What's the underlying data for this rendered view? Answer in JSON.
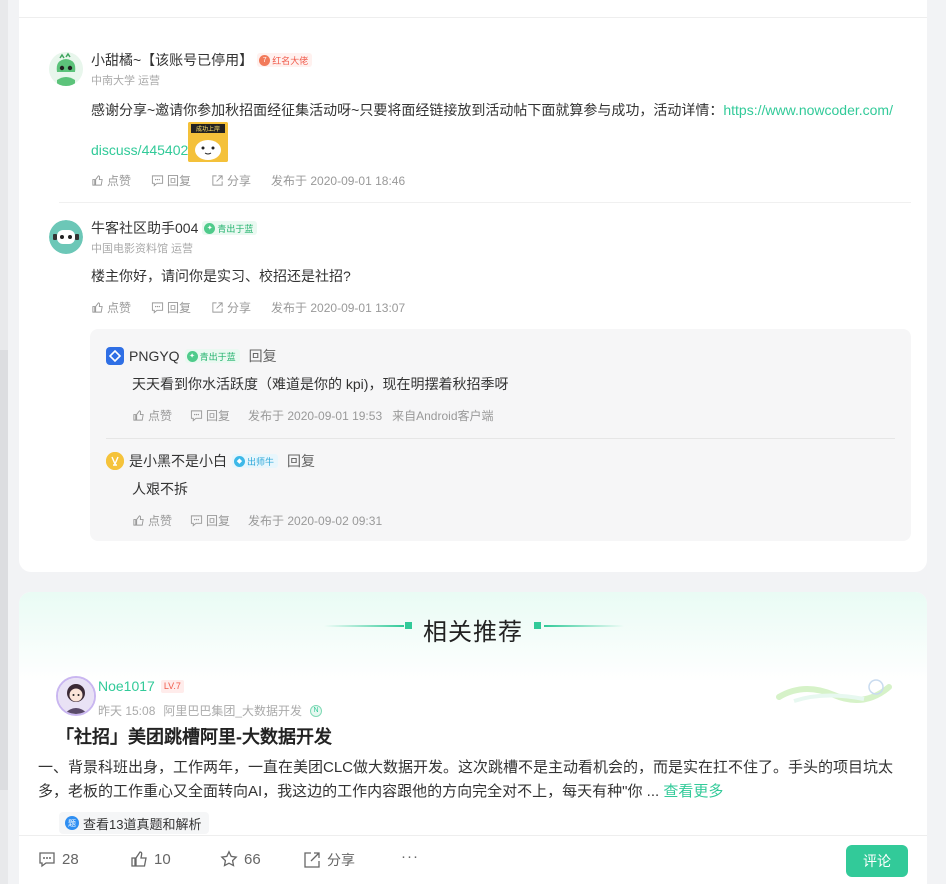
{
  "comments": [
    {
      "name": "小甜橘~【该账号已停用】",
      "badge": "红名大佬",
      "badge_num": "7",
      "sub": "中南大学 运营",
      "text_line1_prefix": "感谢分享~邀请你参加秋招面经征集活动呀~只要将面经链接放到活动帖下面就算参与成功，活动详情：",
      "link_part1": "https://www.nowcoder.com/",
      "link_part2": "discuss/445402",
      "sticker_text": "成功上岸",
      "like": "点赞",
      "reply": "回复",
      "share": "分享",
      "time": "发布于 2020-09-01 18:46"
    },
    {
      "name": "牛客社区助手004",
      "badge": "青出于蓝",
      "sub": "中国电影资料馆 运营",
      "text": "楼主你好，请问你是实习、校招还是社招?",
      "like": "点赞",
      "reply": "回复",
      "share": "分享",
      "time": "发布于 2020-09-01 13:07"
    }
  ],
  "replies": [
    {
      "name": "PNGYQ",
      "badge": "青出于蓝",
      "reply_label": "回复",
      "text": "天天看到你水活跃度（难道是你的 kpi)，现在明摆着秋招季呀",
      "like": "点赞",
      "reply": "回复",
      "time": "发布于 2020-09-01 19:53",
      "source": "来自Android客户端"
    },
    {
      "name": "是小黑不是小白",
      "badge": "出师牛",
      "reply_label": "回复",
      "text": "人艰不拆",
      "like": "点赞",
      "reply": "回复",
      "time": "发布于 2020-09-02 09:31"
    }
  ],
  "recommend": {
    "title": "相关推荐",
    "post": {
      "author": "Noe1017",
      "level": "LV.7",
      "time": "昨天 15:08",
      "company": "阿里巴巴集团_大数据开发",
      "company_badge": "N",
      "title": "「社招」美团跳槽阿里-大数据开发",
      "body": "一、背景科班出身，工作两年，一直在美团CLC做大数据开发。这次跳槽不是主动看机会的，而是实在扛不住了。手头的项目坑太多，老板的工作重心又全面转向AI，我这边的工作内容跟他的方向完全对不上，每天有种\"你 ...",
      "more": "查看更多",
      "chip": "查看13道真题和解析",
      "chip_icon": "题"
    }
  },
  "bottom": {
    "comments_count": "28",
    "likes_count": "10",
    "stars_count": "66",
    "share": "分享",
    "more": "···",
    "comment_button": "评论"
  },
  "colors": {
    "accent": "#32ca99",
    "red": "#f05a4a"
  }
}
